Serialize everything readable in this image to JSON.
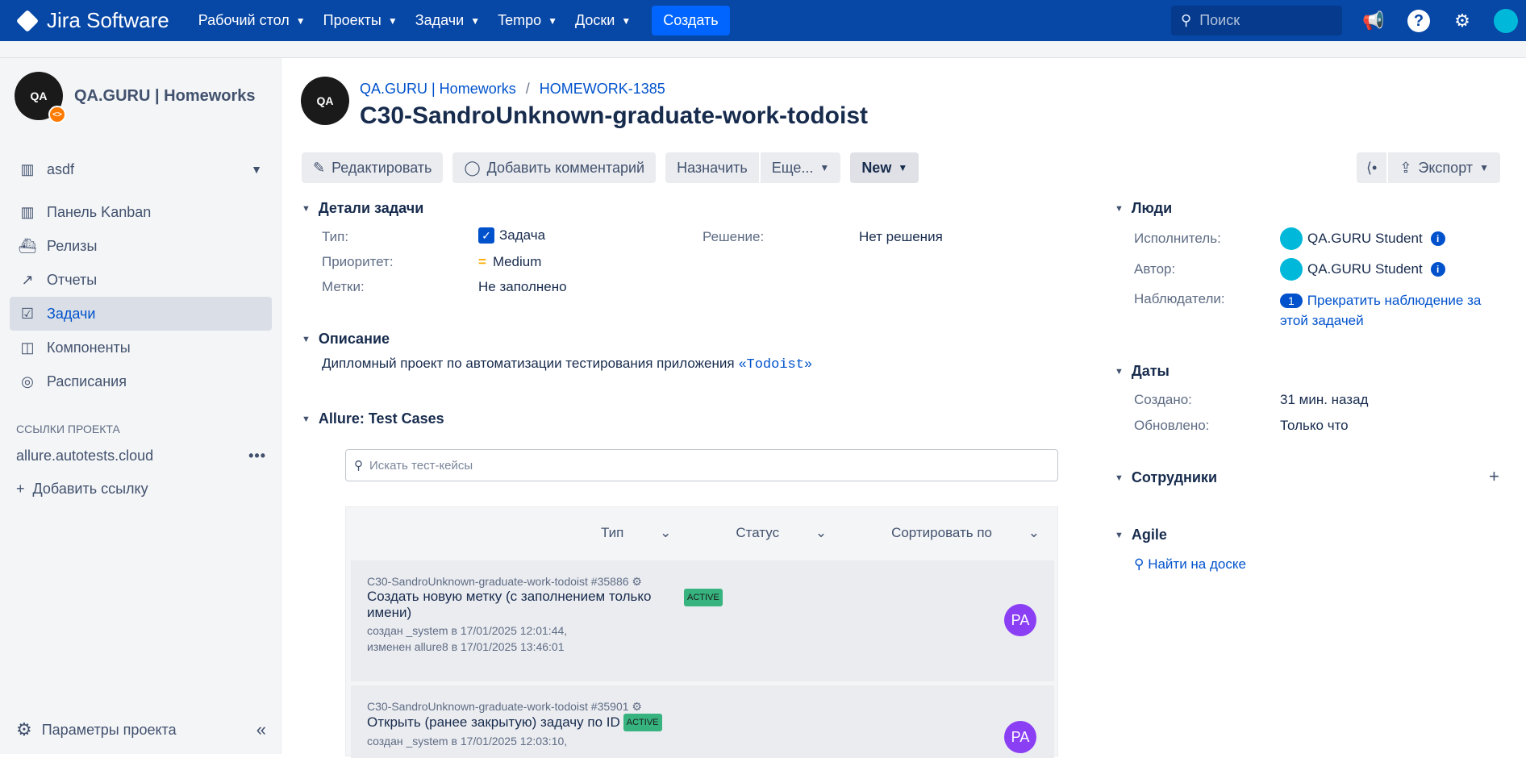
{
  "topbar": {
    "app_name": "Jira Software",
    "nav": [
      "Рабочий стол",
      "Проекты",
      "Задачи",
      "Tempo",
      "Доски"
    ],
    "create_label": "Создать",
    "search_placeholder": "Поиск"
  },
  "sidebar": {
    "project_name": "QA.GURU | Homeworks",
    "board_selector": "asdf",
    "items": [
      "Панель Kanban",
      "Релизы",
      "Отчеты",
      "Задачи",
      "Компоненты",
      "Расписания"
    ],
    "active_item": "Задачи",
    "links_section": "ССЫЛКИ ПРОЕКТА",
    "link": "allure.autotests.cloud",
    "add_link": "Добавить ссылку",
    "settings": "Параметры проекта"
  },
  "issue": {
    "breadcrumb_project": "QA.GURU | Homeworks",
    "breadcrumb_key": "HOMEWORK-1385",
    "title": "C30-SandroUnknown-graduate-work-todoist"
  },
  "toolbar": {
    "edit": "Редактировать",
    "comment": "Добавить комментарий",
    "assign": "Назначить",
    "more": "Еще...",
    "status": "New",
    "export": "Экспорт"
  },
  "details": {
    "header": "Детали задачи",
    "type_label": "Тип:",
    "type_value": "Задача",
    "priority_label": "Приоритет:",
    "priority_value": "Medium",
    "labels_label": "Метки:",
    "labels_value": "Не заполнено",
    "resolution_label": "Решение:",
    "resolution_value": "Нет решения"
  },
  "description": {
    "header": "Описание",
    "text": "Дипломный проект по автоматизации тестирования приложения",
    "link": "«Todoist»"
  },
  "allure": {
    "header": "Allure: Test Cases",
    "search_placeholder": "Искать тест-кейсы",
    "filters": [
      "Тип",
      "Статус",
      "Сортировать по"
    ],
    "cases": [
      {
        "id": "C30-SandroUnknown-graduate-work-todoist #35886",
        "name": "Создать новую метку (с заполнением только имени)",
        "badge": "ACTIVE",
        "created": "создан _system в 17/01/2025 12:01:44,",
        "modified": " изменен allure8 в 17/01/2025 13:46:01",
        "avatar": "PA"
      },
      {
        "id": "C30-SandroUnknown-graduate-work-todoist #35901",
        "name": "Открыть (ранее закрытую) задачу по ID",
        "badge": "ACTIVE",
        "created": "создан _system в 17/01/2025 12:03:10,",
        "modified": "",
        "avatar": "PA"
      }
    ]
  },
  "people": {
    "header": "Люди",
    "assignee_label": "Исполнитель:",
    "assignee": "QA.GURU Student",
    "reporter_label": "Автор:",
    "reporter": "QA.GURU Student",
    "watchers_label": "Наблюдатели:",
    "watchers_count": "1",
    "watch_line1": "Прекратить наблюдение за",
    "watch_line2": "этой задачей"
  },
  "dates": {
    "header": "Даты",
    "created_label": "Создано:",
    "created": "31 мин. назад",
    "updated_label": "Обновлено:",
    "updated": "Только что"
  },
  "employees": {
    "header": "Сотрудники"
  },
  "agile": {
    "header": "Agile",
    "link": "Найти на доске"
  }
}
